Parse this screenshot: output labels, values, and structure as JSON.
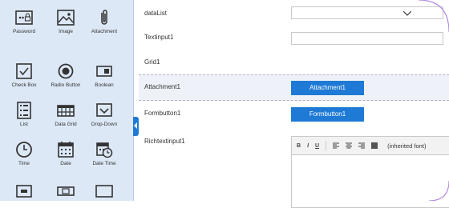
{
  "palette": {
    "tools": [
      {
        "label": "Password",
        "icon": "password-icon"
      },
      {
        "label": "Image",
        "icon": "image-icon"
      },
      {
        "label": "Attachment",
        "icon": "paperclip-icon"
      },
      {
        "label": "Check Box",
        "icon": "checkbox-icon"
      },
      {
        "label": "Radio Button",
        "icon": "radio-icon"
      },
      {
        "label": "Boolean",
        "icon": "toggle-icon"
      },
      {
        "label": "List",
        "icon": "list-icon"
      },
      {
        "label": "Data Grid",
        "icon": "grid-icon"
      },
      {
        "label": "Drop-Down",
        "icon": "dropdown-icon"
      },
      {
        "label": "Time",
        "icon": "clock-icon"
      },
      {
        "label": "Date",
        "icon": "calendar-icon"
      },
      {
        "label": "Date Time",
        "icon": "calendar-clock-icon"
      },
      {
        "label": "",
        "icon": "textbox-icon"
      },
      {
        "label": "",
        "icon": "button-icon"
      },
      {
        "label": "",
        "icon": "panel-icon"
      }
    ]
  },
  "form": {
    "fields": {
      "datalist": {
        "label": "dataList"
      },
      "textinput": {
        "label": "Textinput1"
      },
      "grid": {
        "label": "Grid1"
      },
      "attachment": {
        "label": "Attachment1",
        "button": "Attachment1"
      },
      "formbutton": {
        "label": "Formbutton1",
        "button": "Formbutton1"
      },
      "richtext": {
        "label": "Richtextinput1",
        "font": "(inherited font)"
      }
    },
    "rte_toolbar": {
      "bold": "B",
      "italic": "I",
      "underline": "U"
    }
  },
  "colors": {
    "accent": "#1f7ad6",
    "palette_bg": "#dde8f6",
    "frame": "#b28be3"
  }
}
